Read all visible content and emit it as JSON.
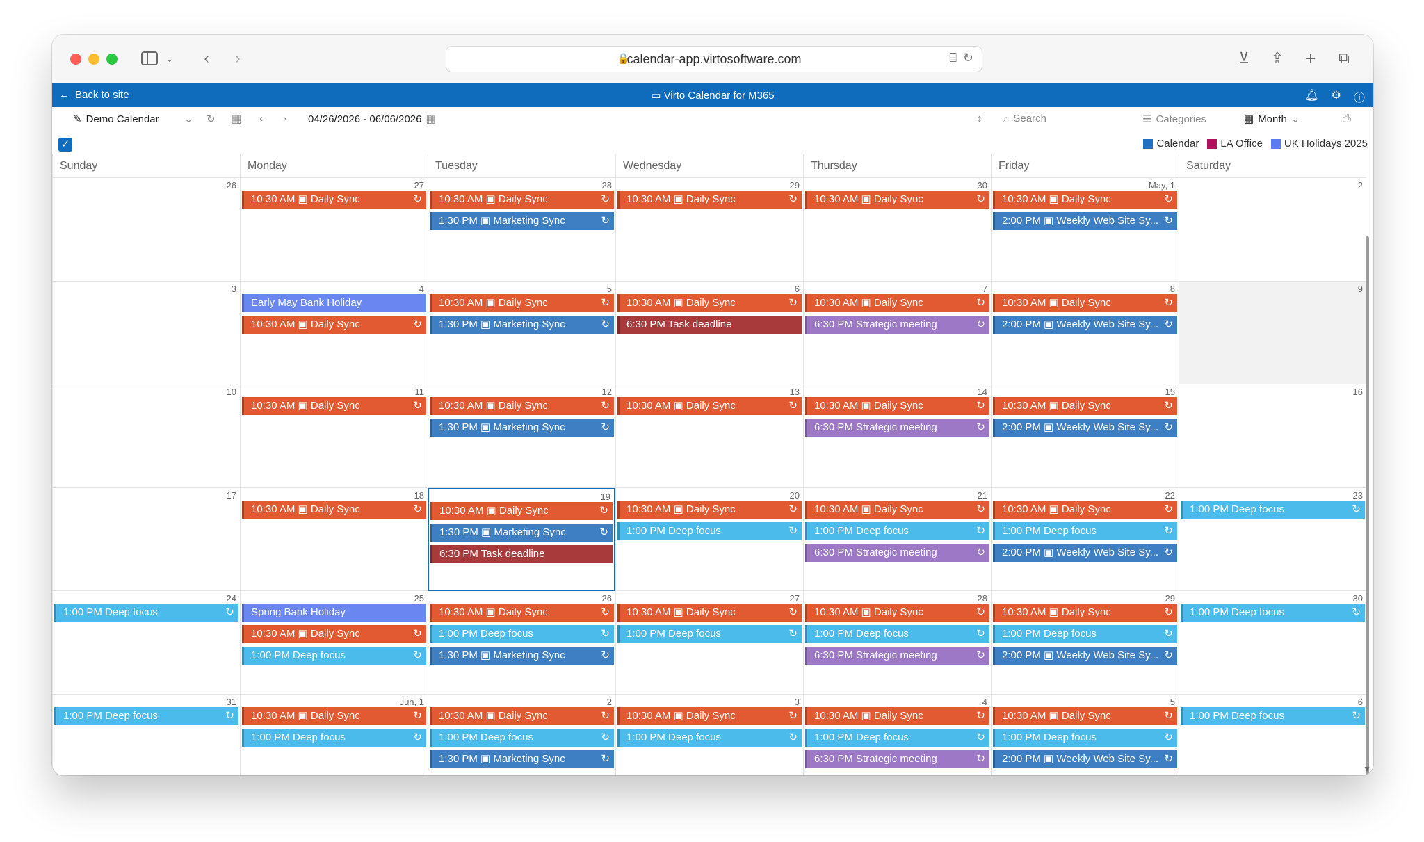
{
  "browser": {
    "url": "calendar-app.virtosoftware.com"
  },
  "app": {
    "back_label": "Back to site",
    "title": "Virto Calendar for M365"
  },
  "toolbar": {
    "calendar_name": "Demo Calendar",
    "date_range": "04/26/2026 - 06/06/2026",
    "search_placeholder": "Search",
    "categories_label": "Categories",
    "view_label": "Month"
  },
  "legend": [
    {
      "label": "Calendar",
      "color": "#1f6fc5"
    },
    {
      "label": "LA Office",
      "color": "#b0105c"
    },
    {
      "label": "UK Holidays 2025",
      "color": "#5a7cf0"
    }
  ],
  "weekdays": [
    "Sunday",
    "Monday",
    "Tuesday",
    "Wednesday",
    "Thursday",
    "Friday",
    "Saturday"
  ],
  "weeks": [
    {
      "days": [
        {
          "num": "26",
          "events": []
        },
        {
          "num": "27",
          "events": [
            {
              "text": "10:30 AM ▣ Daily Sync",
              "color": "orange",
              "rec": true
            }
          ]
        },
        {
          "num": "28",
          "events": [
            {
              "text": "10:30 AM ▣ Daily Sync",
              "color": "orange",
              "rec": true
            },
            {
              "text": "1:30 PM ▣ Marketing Sync",
              "color": "blue",
              "rec": true
            }
          ]
        },
        {
          "num": "29",
          "events": [
            {
              "text": "10:30 AM ▣ Daily Sync",
              "color": "orange",
              "rec": true
            }
          ]
        },
        {
          "num": "30",
          "events": [
            {
              "text": "10:30 AM ▣ Daily Sync",
              "color": "orange",
              "rec": true
            }
          ]
        },
        {
          "num": "May, 1",
          "events": [
            {
              "text": "10:30 AM ▣ Daily Sync",
              "color": "orange",
              "rec": true
            },
            {
              "text": "2:00 PM ▣ Weekly Web Site Sy...",
              "color": "blue",
              "rec": true
            }
          ]
        },
        {
          "num": "2",
          "events": []
        }
      ]
    },
    {
      "days": [
        {
          "num": "3",
          "events": []
        },
        {
          "num": "4",
          "events": [
            {
              "text": "Early May Bank Holiday",
              "color": "holiday",
              "rec": false
            },
            {
              "text": "10:30 AM ▣ Daily Sync",
              "color": "orange",
              "rec": true
            }
          ]
        },
        {
          "num": "5",
          "events": [
            {
              "text": "10:30 AM ▣ Daily Sync",
              "color": "orange",
              "rec": true
            },
            {
              "text": "1:30 PM ▣ Marketing Sync",
              "color": "blue",
              "rec": true
            }
          ]
        },
        {
          "num": "6",
          "events": [
            {
              "text": "10:30 AM ▣ Daily Sync",
              "color": "orange",
              "rec": true
            },
            {
              "text": "6:30 PM Task deadline",
              "color": "maroon",
              "rec": false
            }
          ]
        },
        {
          "num": "7",
          "events": [
            {
              "text": "10:30 AM ▣ Daily Sync",
              "color": "orange",
              "rec": true
            },
            {
              "text": "6:30 PM Strategic meeting",
              "color": "purple",
              "rec": true
            }
          ]
        },
        {
          "num": "8",
          "events": [
            {
              "text": "10:30 AM ▣ Daily Sync",
              "color": "orange",
              "rec": true
            },
            {
              "text": "2:00 PM ▣ Weekly Web Site Sy...",
              "color": "blue",
              "rec": true
            }
          ]
        },
        {
          "num": "9",
          "events": []
        }
      ]
    },
    {
      "days": [
        {
          "num": "10",
          "events": []
        },
        {
          "num": "11",
          "events": [
            {
              "text": "10:30 AM ▣ Daily Sync",
              "color": "orange",
              "rec": true
            }
          ]
        },
        {
          "num": "12",
          "events": [
            {
              "text": "10:30 AM ▣ Daily Sync",
              "color": "orange",
              "rec": true
            },
            {
              "text": "1:30 PM ▣ Marketing Sync",
              "color": "blue",
              "rec": true
            }
          ]
        },
        {
          "num": "13",
          "events": [
            {
              "text": "10:30 AM ▣ Daily Sync",
              "color": "orange",
              "rec": true
            }
          ]
        },
        {
          "num": "14",
          "events": [
            {
              "text": "10:30 AM ▣ Daily Sync",
              "color": "orange",
              "rec": true
            },
            {
              "text": "6:30 PM Strategic meeting",
              "color": "purple",
              "rec": true
            }
          ]
        },
        {
          "num": "15",
          "events": [
            {
              "text": "10:30 AM ▣ Daily Sync",
              "color": "orange",
              "rec": true
            },
            {
              "text": "2:00 PM ▣ Weekly Web Site Sy...",
              "color": "blue",
              "rec": true
            }
          ]
        },
        {
          "num": "16",
          "events": []
        }
      ]
    },
    {
      "days": [
        {
          "num": "17",
          "events": []
        },
        {
          "num": "18",
          "events": [
            {
              "text": "10:30 AM ▣ Daily Sync",
              "color": "orange",
              "rec": true
            }
          ]
        },
        {
          "num": "19",
          "events": [
            {
              "text": "10:30 AM ▣ Daily Sync",
              "color": "orange",
              "rec": true
            },
            {
              "text": "1:30 PM ▣ Marketing Sync",
              "color": "blue",
              "rec": true
            },
            {
              "text": "6:30 PM Task deadline",
              "color": "maroon",
              "rec": false
            }
          ]
        },
        {
          "num": "20",
          "events": [
            {
              "text": "10:30 AM ▣ Daily Sync",
              "color": "orange",
              "rec": true
            },
            {
              "text": "1:00 PM Deep focus",
              "color": "sky",
              "rec": true
            }
          ]
        },
        {
          "num": "21",
          "events": [
            {
              "text": "10:30 AM ▣ Daily Sync",
              "color": "orange",
              "rec": true
            },
            {
              "text": "1:00 PM Deep focus",
              "color": "sky",
              "rec": true
            },
            {
              "text": "6:30 PM Strategic meeting",
              "color": "purple",
              "rec": true
            }
          ]
        },
        {
          "num": "22",
          "events": [
            {
              "text": "10:30 AM ▣ Daily Sync",
              "color": "orange",
              "rec": true
            },
            {
              "text": "1:00 PM Deep focus",
              "color": "sky",
              "rec": true
            },
            {
              "text": "2:00 PM ▣ Weekly Web Site Sy...",
              "color": "blue",
              "rec": true
            }
          ]
        },
        {
          "num": "23",
          "events": [
            {
              "text": "1:00 PM Deep focus",
              "color": "sky",
              "rec": true
            }
          ]
        }
      ]
    },
    {
      "days": [
        {
          "num": "24",
          "events": [
            {
              "text": "1:00 PM Deep focus",
              "color": "sky",
              "rec": true
            }
          ]
        },
        {
          "num": "25",
          "events": [
            {
              "text": "Spring Bank Holiday",
              "color": "holiday",
              "rec": false
            },
            {
              "text": "10:30 AM ▣ Daily Sync",
              "color": "orange",
              "rec": true
            },
            {
              "text": "1:00 PM Deep focus",
              "color": "sky",
              "rec": true
            }
          ]
        },
        {
          "num": "26",
          "events": [
            {
              "text": "10:30 AM ▣ Daily Sync",
              "color": "orange",
              "rec": true
            },
            {
              "text": "1:00 PM Deep focus",
              "color": "sky",
              "rec": true
            },
            {
              "text": "1:30 PM ▣ Marketing Sync",
              "color": "blue",
              "rec": true
            }
          ]
        },
        {
          "num": "27",
          "events": [
            {
              "text": "10:30 AM ▣ Daily Sync",
              "color": "orange",
              "rec": true
            },
            {
              "text": "1:00 PM Deep focus",
              "color": "sky",
              "rec": true
            }
          ]
        },
        {
          "num": "28",
          "events": [
            {
              "text": "10:30 AM ▣ Daily Sync",
              "color": "orange",
              "rec": true
            },
            {
              "text": "1:00 PM Deep focus",
              "color": "sky",
              "rec": true
            },
            {
              "text": "6:30 PM Strategic meeting",
              "color": "purple",
              "rec": true
            }
          ]
        },
        {
          "num": "29",
          "events": [
            {
              "text": "10:30 AM ▣ Daily Sync",
              "color": "orange",
              "rec": true
            },
            {
              "text": "1:00 PM Deep focus",
              "color": "sky",
              "rec": true
            },
            {
              "text": "2:00 PM ▣ Weekly Web Site Sy...",
              "color": "blue",
              "rec": true
            }
          ]
        },
        {
          "num": "30",
          "events": [
            {
              "text": "1:00 PM Deep focus",
              "color": "sky",
              "rec": true
            }
          ]
        }
      ]
    },
    {
      "days": [
        {
          "num": "31",
          "events": [
            {
              "text": "1:00 PM Deep focus",
              "color": "sky",
              "rec": true
            }
          ]
        },
        {
          "num": "Jun, 1",
          "events": [
            {
              "text": "10:30 AM ▣ Daily Sync",
              "color": "orange",
              "rec": true
            },
            {
              "text": "1:00 PM Deep focus",
              "color": "sky",
              "rec": true
            }
          ]
        },
        {
          "num": "2",
          "events": [
            {
              "text": "10:30 AM ▣ Daily Sync",
              "color": "orange",
              "rec": true
            },
            {
              "text": "1:00 PM Deep focus",
              "color": "sky",
              "rec": true
            },
            {
              "text": "1:30 PM ▣ Marketing Sync",
              "color": "blue",
              "rec": true
            }
          ]
        },
        {
          "num": "3",
          "events": [
            {
              "text": "10:30 AM ▣ Daily Sync",
              "color": "orange",
              "rec": true
            },
            {
              "text": "1:00 PM Deep focus",
              "color": "sky",
              "rec": true
            }
          ]
        },
        {
          "num": "4",
          "events": [
            {
              "text": "10:30 AM ▣ Daily Sync",
              "color": "orange",
              "rec": true
            },
            {
              "text": "1:00 PM Deep focus",
              "color": "sky",
              "rec": true
            },
            {
              "text": "6:30 PM Strategic meeting",
              "color": "purple",
              "rec": true
            }
          ]
        },
        {
          "num": "5",
          "events": [
            {
              "text": "10:30 AM ▣ Daily Sync",
              "color": "orange",
              "rec": true
            },
            {
              "text": "1:00 PM Deep focus",
              "color": "sky",
              "rec": true
            },
            {
              "text": "2:00 PM ▣ Weekly Web Site Sy...",
              "color": "blue",
              "rec": true
            }
          ]
        },
        {
          "num": "6",
          "events": [
            {
              "text": "1:00 PM Deep focus",
              "color": "sky",
              "rec": true
            }
          ]
        }
      ]
    }
  ]
}
